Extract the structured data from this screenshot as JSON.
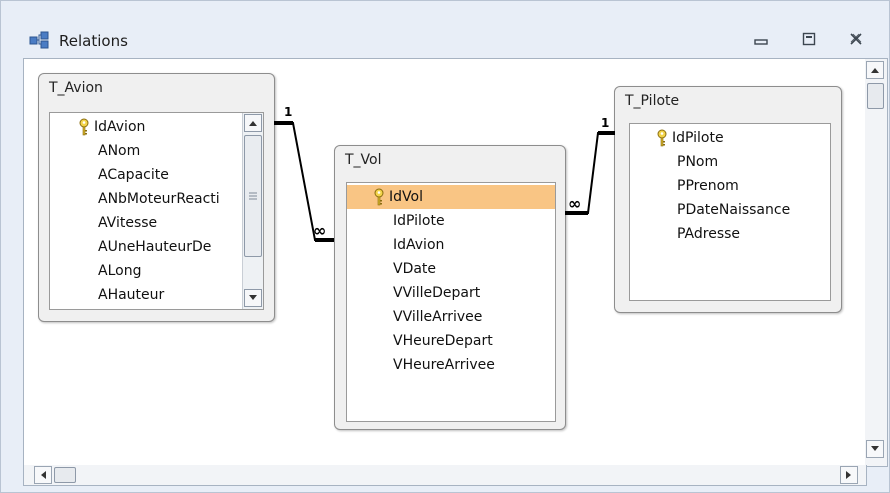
{
  "window": {
    "title": "Relations",
    "icon": "relationships-icon",
    "controls": [
      "minimize-icon",
      "maximize-icon",
      "close-icon"
    ]
  },
  "tables": {
    "avion": {
      "name": "T_Avion",
      "fields": [
        "IdAvion",
        "ANom",
        "ACapacite",
        "ANbMoteurReacti",
        "AVitesse",
        "AUneHauteurDe",
        "ALong",
        "AHauteur"
      ],
      "key_field": "IdAvion"
    },
    "vol": {
      "name": "T_Vol",
      "fields": [
        "IdVol",
        "IdPilote",
        "IdAvion",
        "VDate",
        "VVilleDepart",
        "VVilleArrivee",
        "VHeureDepart",
        "VHeureArrivee"
      ],
      "key_field": "IdVol",
      "selected_field": "IdVol"
    },
    "pilote": {
      "name": "T_Pilote",
      "fields": [
        "IdPilote",
        "PNom",
        "PPrenom",
        "PDateNaissance",
        "PAdresse"
      ],
      "key_field": "IdPilote"
    }
  },
  "relationships": [
    {
      "from": "T_Avion.IdAvion",
      "to": "T_Vol.IdAvion",
      "one_label": "1",
      "many_label": "∞"
    },
    {
      "from": "T_Pilote.IdPilote",
      "to": "T_Vol.IdPilote",
      "one_label": "1",
      "many_label": "∞"
    }
  ]
}
